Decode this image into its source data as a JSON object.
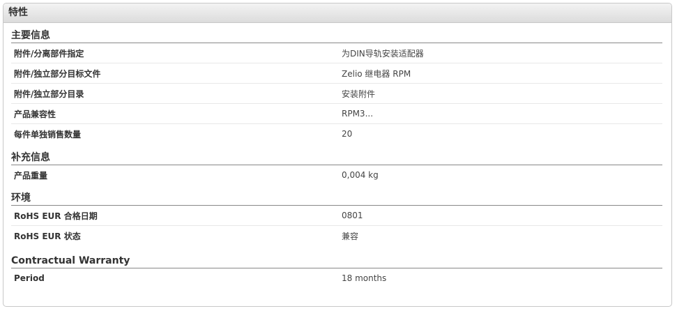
{
  "panel": {
    "title": "特性"
  },
  "sections": [
    {
      "title": "主要信息",
      "rows": [
        {
          "label": "附件/分离部件指定",
          "value": "为DIN导轨安装适配器"
        },
        {
          "label": "附件/独立部分目标文件",
          "value": "Zelio 继电器 RPM"
        },
        {
          "label": "附件/独立部分目录",
          "value": "安装附件"
        },
        {
          "label": "产品兼容性",
          "value": "RPM3..."
        },
        {
          "label": "每件单独销售数量",
          "value": "20"
        }
      ]
    },
    {
      "title": "补充信息",
      "rows": [
        {
          "label": "产品重量",
          "value": "0,004 kg"
        }
      ]
    },
    {
      "title": "环境",
      "rows": [
        {
          "label": "RoHS EUR 合格日期",
          "value": "0801"
        },
        {
          "label": "RoHS EUR 状态",
          "value": "兼容"
        }
      ]
    },
    {
      "title": "Contractual Warranty",
      "rows": [
        {
          "label": "Period",
          "value": "18 months"
        }
      ]
    }
  ]
}
